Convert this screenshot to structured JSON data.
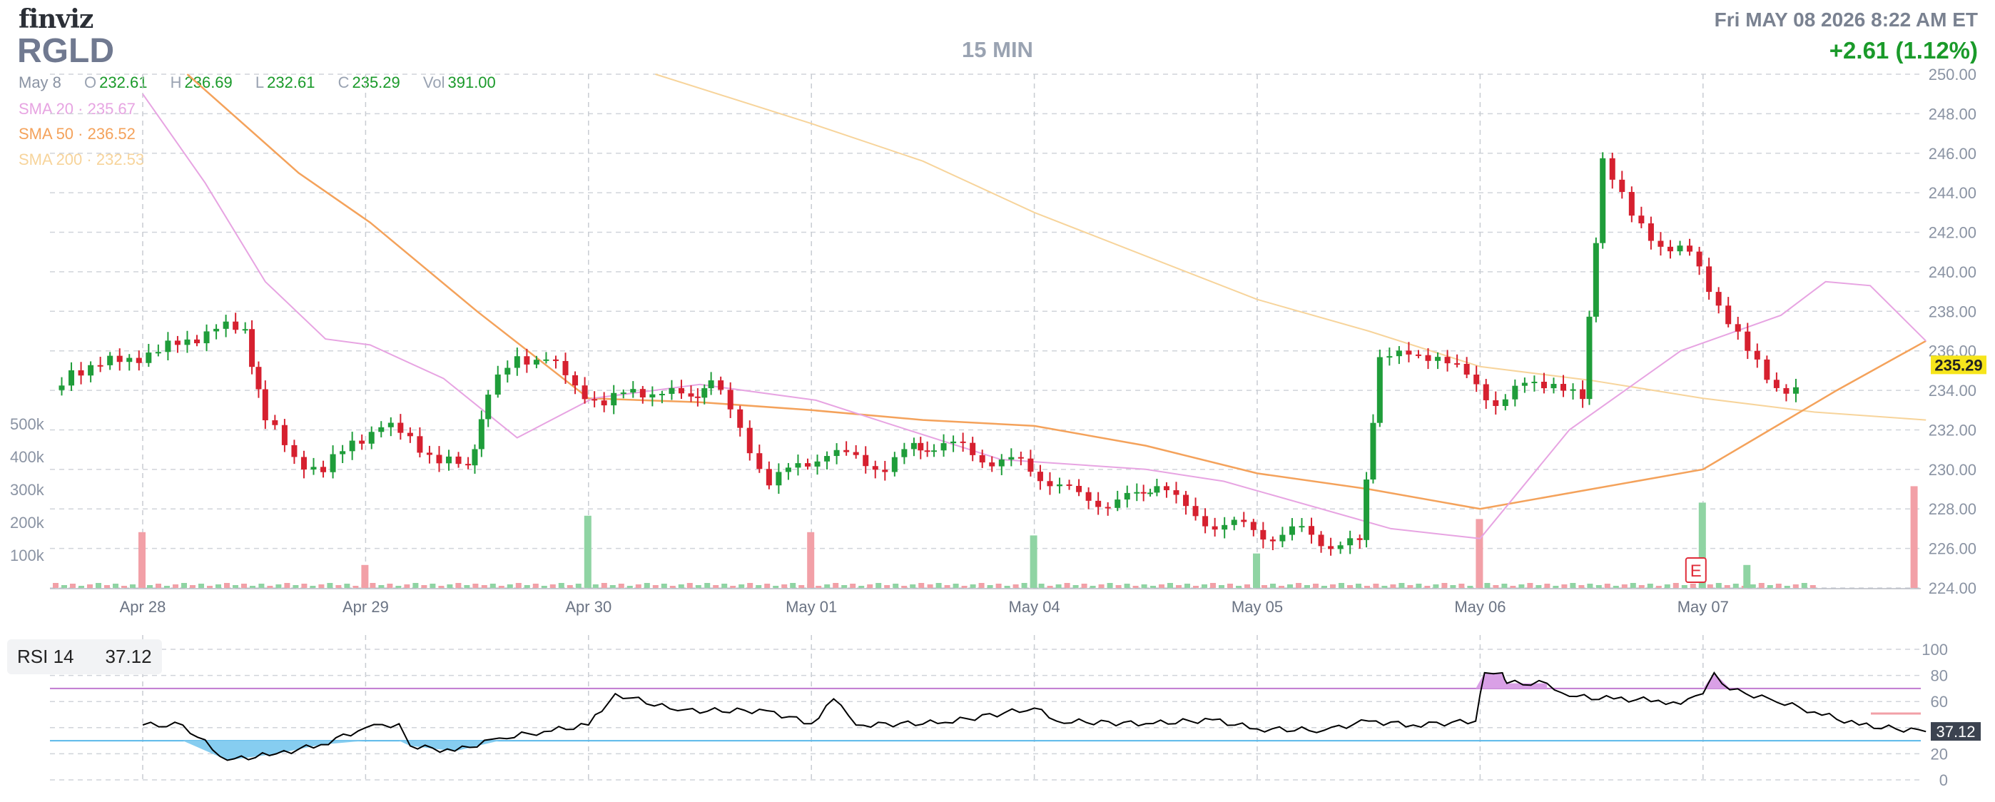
{
  "header": {
    "logo": "finviz",
    "ticker": "RGLD",
    "interval": "15 MIN",
    "datetime": "Fri MAY 08 2026 8:22 AM ET",
    "change": "+2.61 (1.12%)"
  },
  "ohlc": {
    "date": "May 8",
    "open_label": "O",
    "open": "232.61",
    "high_label": "H",
    "high": "236.69",
    "low_label": "L",
    "low": "232.61",
    "close_label": "C",
    "close": "235.29",
    "vol_label": "Vol",
    "volume": "391.00"
  },
  "indicators": {
    "sma20": {
      "label": "SMA 20",
      "value": "235.67",
      "color": "#e7a4e2"
    },
    "sma50": {
      "label": "SMA 50",
      "value": "236.52",
      "color": "#f4a25b"
    },
    "sma200": {
      "label": "SMA 200",
      "value": "232.53",
      "color": "#f7d49b"
    }
  },
  "rsi": {
    "label": "RSI 14",
    "value": "37.12"
  },
  "colors": {
    "up": "#1f9d3a",
    "down": "#d6202f",
    "vol_up": "#8fd4a3",
    "vol_down": "#f2a0a7",
    "price_tag_bg": "#f6e51c",
    "rsi_line": "#000000",
    "rsi_over": "#d9a0e6",
    "rsi_under": "#86cdf0",
    "rsi_70": "#c07ad0",
    "rsi_30": "#5ab8ea"
  },
  "chart_data": {
    "type": "candlestick",
    "x_ticks": [
      "Apr 28",
      "Apr 29",
      "Apr 30",
      "May 01",
      "May 04",
      "May 05",
      "May 06",
      "May 07"
    ],
    "y_ticks": [
      "224.00",
      "226.00",
      "228.00",
      "230.00",
      "232.00",
      "234.00",
      "236.00",
      "238.00",
      "240.00",
      "242.00",
      "244.00",
      "246.00",
      "248.00",
      "250.00"
    ],
    "ylim": [
      224,
      250
    ],
    "last_price": "235.29",
    "volume_ticks": [
      "100k",
      "200k",
      "300k",
      "400k",
      "500k"
    ],
    "earnings_marker": {
      "label": "E",
      "at_day": "May 07"
    },
    "day_closes": [
      [
        233.0,
        235.0,
        235.3,
        235.6,
        236.0,
        236.5,
        237.2,
        237.0
      ],
      [
        232.6,
        230.5,
        230.0,
        231.3,
        232.3,
        231.5,
        230.5,
        230.0
      ],
      [
        234.0,
        235.5,
        235.8,
        234.0,
        233.5,
        233.8,
        234.1,
        233.4
      ],
      [
        234.8,
        231.8,
        229.5,
        230.0,
        231.0,
        230.4,
        230.2,
        231.0
      ],
      [
        231.3,
        231.0,
        230.5,
        230.2,
        229.5,
        228.5,
        228.4,
        228.5
      ],
      [
        229.5,
        227.8,
        227.3,
        227.0,
        226.7,
        226.8,
        226.3,
        226.1
      ],
      [
        236.0,
        235.5,
        236.0,
        234.5,
        233.5,
        234.1,
        234.6,
        233.3
      ],
      [
        246.0,
        242.6,
        241.5,
        240.8,
        238.5,
        235.8,
        234.3,
        233.7
      ]
    ],
    "sma20": [
      [
        0,
        249
      ],
      [
        0.28,
        244.5
      ],
      [
        0.55,
        239.5
      ],
      [
        0.82,
        236.6
      ],
      [
        1.02,
        236.3
      ],
      [
        1.35,
        234.6
      ],
      [
        1.68,
        231.6
      ],
      [
        2.02,
        233.6
      ],
      [
        2.5,
        234.3
      ],
      [
        3.02,
        233.5
      ],
      [
        3.35,
        232.3
      ],
      [
        3.85,
        230.5
      ],
      [
        4.5,
        230.0
      ],
      [
        4.85,
        229.4
      ],
      [
        5.6,
        227.0
      ],
      [
        6.0,
        226.5
      ],
      [
        6.4,
        232.0
      ],
      [
        6.9,
        236.0
      ],
      [
        7.35,
        237.8
      ],
      [
        7.55,
        239.5
      ],
      [
        7.75,
        239.3
      ],
      [
        8.0,
        236.5
      ]
    ],
    "sma50": [
      [
        0.2,
        250
      ],
      [
        0.7,
        245.0
      ],
      [
        1.02,
        242.5
      ],
      [
        1.5,
        238.0
      ],
      [
        2.0,
        233.6
      ],
      [
        2.5,
        233.4
      ],
      [
        3.0,
        233.0
      ],
      [
        3.5,
        232.5
      ],
      [
        4.0,
        232.2
      ],
      [
        4.5,
        231.2
      ],
      [
        5.0,
        229.8
      ],
      [
        5.5,
        229.0
      ],
      [
        6.0,
        228.0
      ],
      [
        6.5,
        229.0
      ],
      [
        7.0,
        230.0
      ],
      [
        7.3,
        232.0
      ],
      [
        7.6,
        234.0
      ],
      [
        8.0,
        236.5
      ]
    ],
    "sma200": [
      [
        2.3,
        250
      ],
      [
        3.0,
        247.5
      ],
      [
        3.5,
        245.6
      ],
      [
        4.0,
        243.0
      ],
      [
        4.5,
        240.8
      ],
      [
        5.0,
        238.6
      ],
      [
        5.5,
        237.0
      ],
      [
        6.0,
        235.2
      ],
      [
        6.5,
        234.5
      ],
      [
        7.0,
        233.6
      ],
      [
        7.5,
        232.9
      ],
      [
        8.0,
        232.5
      ]
    ],
    "rsi_ylim": [
      0,
      100
    ],
    "rsi_ticks": [
      "0",
      "20",
      "40",
      "60",
      "80",
      "100"
    ],
    "rsi_levels": {
      "overbought": 70,
      "oversold": 30
    },
    "rsi": [
      [
        0,
        42
      ],
      [
        0.18,
        42
      ],
      [
        0.38,
        15
      ],
      [
        0.6,
        20
      ],
      [
        0.8,
        27
      ],
      [
        1.0,
        40
      ],
      [
        1.15,
        43
      ],
      [
        1.2,
        26
      ],
      [
        1.4,
        22
      ],
      [
        1.6,
        32
      ],
      [
        1.8,
        37
      ],
      [
        2.0,
        42
      ],
      [
        2.12,
        66
      ],
      [
        2.4,
        53
      ],
      [
        2.8,
        53
      ],
      [
        3.0,
        43
      ],
      [
        3.1,
        62
      ],
      [
        3.2,
        42
      ],
      [
        3.6,
        44
      ],
      [
        4.0,
        55
      ],
      [
        4.1,
        45
      ],
      [
        4.5,
        43
      ],
      [
        4.8,
        46
      ],
      [
        5.0,
        39
      ],
      [
        5.3,
        38
      ],
      [
        5.5,
        45
      ],
      [
        5.7,
        42
      ],
      [
        5.98,
        45
      ],
      [
        6.02,
        82
      ],
      [
        6.1,
        82
      ],
      [
        6.12,
        74
      ],
      [
        6.3,
        74
      ],
      [
        6.4,
        64
      ],
      [
        6.6,
        62
      ],
      [
        6.8,
        61
      ],
      [
        6.9,
        58
      ],
      [
        7.0,
        66
      ],
      [
        7.05,
        82
      ],
      [
        7.12,
        69
      ],
      [
        7.3,
        62
      ],
      [
        7.5,
        52
      ],
      [
        7.7,
        42
      ],
      [
        8.0,
        37
      ]
    ],
    "volume_spikes": [
      {
        "day": 0,
        "k": 170,
        "dir": "down"
      },
      {
        "day": 1,
        "k": 70,
        "dir": "down"
      },
      {
        "day": 2,
        "k": 220,
        "dir": "up"
      },
      {
        "day": 3,
        "k": 170,
        "dir": "down"
      },
      {
        "day": 4,
        "k": 160,
        "dir": "up"
      },
      {
        "day": 5,
        "k": 105,
        "dir": "up"
      },
      {
        "day": 6,
        "k": 210,
        "dir": "down"
      },
      {
        "day": 7,
        "k": 260,
        "dir": "up"
      },
      {
        "day": 7.2,
        "k": 70,
        "dir": "up"
      },
      {
        "day": 7.95,
        "k": 310,
        "dir": "down"
      }
    ]
  }
}
